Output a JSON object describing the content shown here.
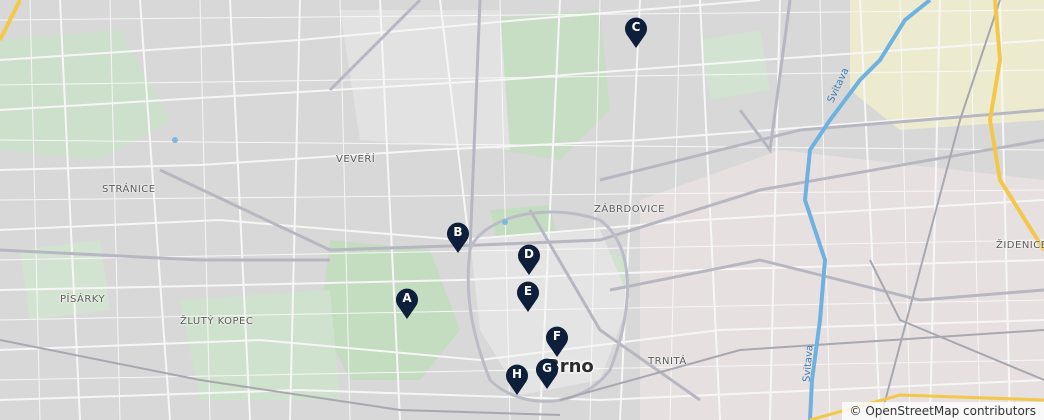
{
  "map": {
    "city_label": "Brno",
    "district_labels": [
      "Veveří",
      "Stránice",
      "Písárky",
      "Žlutý Kopec",
      "Zábrdovice",
      "Židenice",
      "Trnitá"
    ],
    "river_label": "Svitava",
    "attribution": "© OpenStreetMap contributors",
    "colors": {
      "marker": "#0d1f3a",
      "park": "#c9e3c9",
      "river": "#6fb2e0",
      "highway": "#f4c84a",
      "industrial": "#e9dede"
    }
  },
  "markers": [
    {
      "label": "A"
    },
    {
      "label": "B"
    },
    {
      "label": "C"
    },
    {
      "label": "D"
    },
    {
      "label": "E"
    },
    {
      "label": "F"
    },
    {
      "label": "G"
    },
    {
      "label": "H"
    }
  ]
}
